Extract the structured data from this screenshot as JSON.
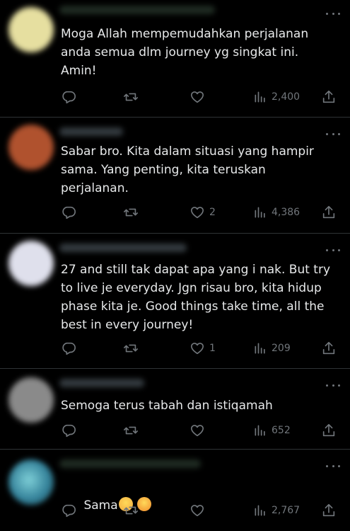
{
  "replies": [
    {
      "text": "Moga Allah mempemudahkan perjalanan\nanda semua dlm journey yg singkat ini.\nAmin!",
      "replies": "",
      "reposts": "",
      "likes": "",
      "views": "2,400",
      "avatar_color": "#e6dfa0"
    },
    {
      "text": "Sabar bro. Kita dalam situasi yang hampir\nsama. Yang penting, kita teruskan\nperjalanan.",
      "replies": "",
      "reposts": "",
      "likes": "2",
      "views": "4,386",
      "avatar_color": "#b0522e"
    },
    {
      "text": "27 and still tak dapat apa yang i nak. But try\nto live je everyday. Jgn risau bro, kita hidup\nphase kita je. Good things take time, all the\nbest in every journey!",
      "replies": "",
      "reposts": "",
      "likes": "1",
      "views": "209",
      "avatar_color": "#dfe0ec"
    },
    {
      "text": "Semoga terus tabah dan istiqamah",
      "replies": "",
      "reposts": "",
      "likes": "",
      "views": "652",
      "avatar_color": "#8a8a8a"
    },
    {
      "text": "Sama",
      "emojis": [
        "weary-face-emoji",
        "confounded-face-emoji"
      ],
      "replies": "",
      "reposts": "",
      "likes": "",
      "views": "2,767",
      "avatar_color": "#4f9fb0"
    }
  ],
  "colors": {
    "background": "#000000",
    "text": "#e7e9ea",
    "muted": "#71767b",
    "divider": "#2f3336",
    "emoji_yellow": "#f6c33b",
    "emoji_orange": "#f2a93b"
  }
}
